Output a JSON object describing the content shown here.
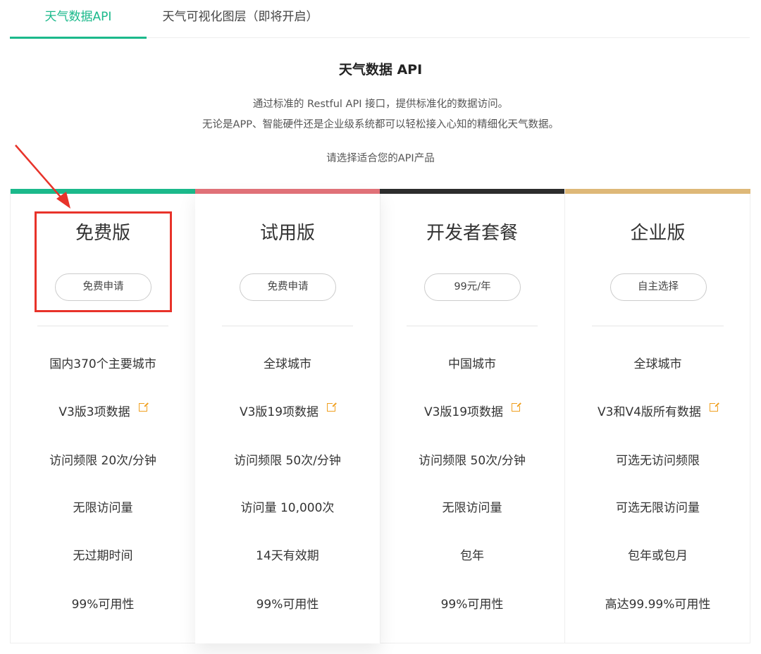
{
  "tabs": [
    {
      "label": "天气数据API",
      "active": true
    },
    {
      "label": "天气可视化图层（即将开启）",
      "active": false
    }
  ],
  "intro": {
    "title": "天气数据 API",
    "line1": "通过标准的 Restful API 接口，提供标准化的数据访问。",
    "line2": "无论是APP、智能硬件还是企业级系统都可以轻松接入心知的精细化天气数据。",
    "prompt": "请选择适合您的API产品"
  },
  "colors": {
    "accent": "#1bb98b",
    "plan_bars": [
      "#1bb98b",
      "#e07178",
      "#2d2d2d",
      "#deb878"
    ],
    "link_icon": "#f0a020",
    "annotation": "#e8332a"
  },
  "plans": [
    {
      "name": "免费版",
      "button": "免费申请",
      "features": [
        "国内370个主要城市",
        "V3版3项数据",
        "访问频限 20次/分钟",
        "无限访问量",
        "无过期时间",
        "99%可用性"
      ]
    },
    {
      "name": "试用版",
      "button": "免费申请",
      "features": [
        "全球城市",
        "V3版19项数据",
        "访问频限 50次/分钟",
        "访问量 10,000次",
        "14天有效期",
        "99%可用性"
      ]
    },
    {
      "name": "开发者套餐",
      "button": "99元/年",
      "features": [
        "中国城市",
        "V3版19项数据",
        "访问频限 50次/分钟",
        "无限访问量",
        "包年",
        "99%可用性"
      ]
    },
    {
      "name": "企业版",
      "button": "自主选择",
      "features": [
        "全球城市",
        "V3和V4版所有数据",
        "可选无访问频限",
        "可选无限访问量",
        "包年或包月",
        "高达99.99%可用性"
      ]
    }
  ],
  "icons": {
    "external_link": "external-link-icon"
  }
}
